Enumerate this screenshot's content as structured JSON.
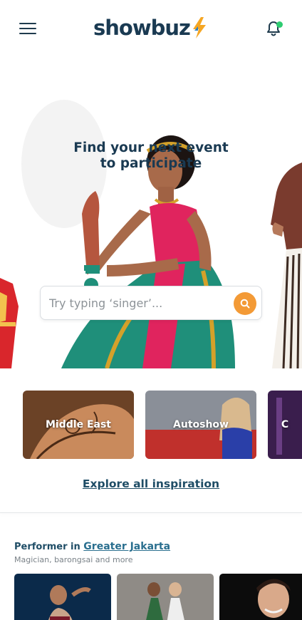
{
  "header": {
    "logo_text": "showbuz",
    "menu_icon": "hamburger-menu-icon",
    "notification_icon": "bell-icon",
    "notification_dot_color": "#2ecc71",
    "brand_color": "#1a3a52",
    "bolt_color": "#f5a623"
  },
  "hero": {
    "title_line1": "Find your next event",
    "title_line2": "to participate",
    "search_placeholder": "Try typing ‘singer’...",
    "search_icon": "search-icon",
    "search_button_color": "#f39a36"
  },
  "inspiration": {
    "cards": [
      {
        "label": "Middle East"
      },
      {
        "label": "Autoshow"
      },
      {
        "label": "C"
      }
    ],
    "explore_label": "Explore all inspiration"
  },
  "performers": {
    "prefix": "Performer in",
    "location": "Greater Jakarta",
    "subtitle": "Magician, barongsai and more"
  }
}
